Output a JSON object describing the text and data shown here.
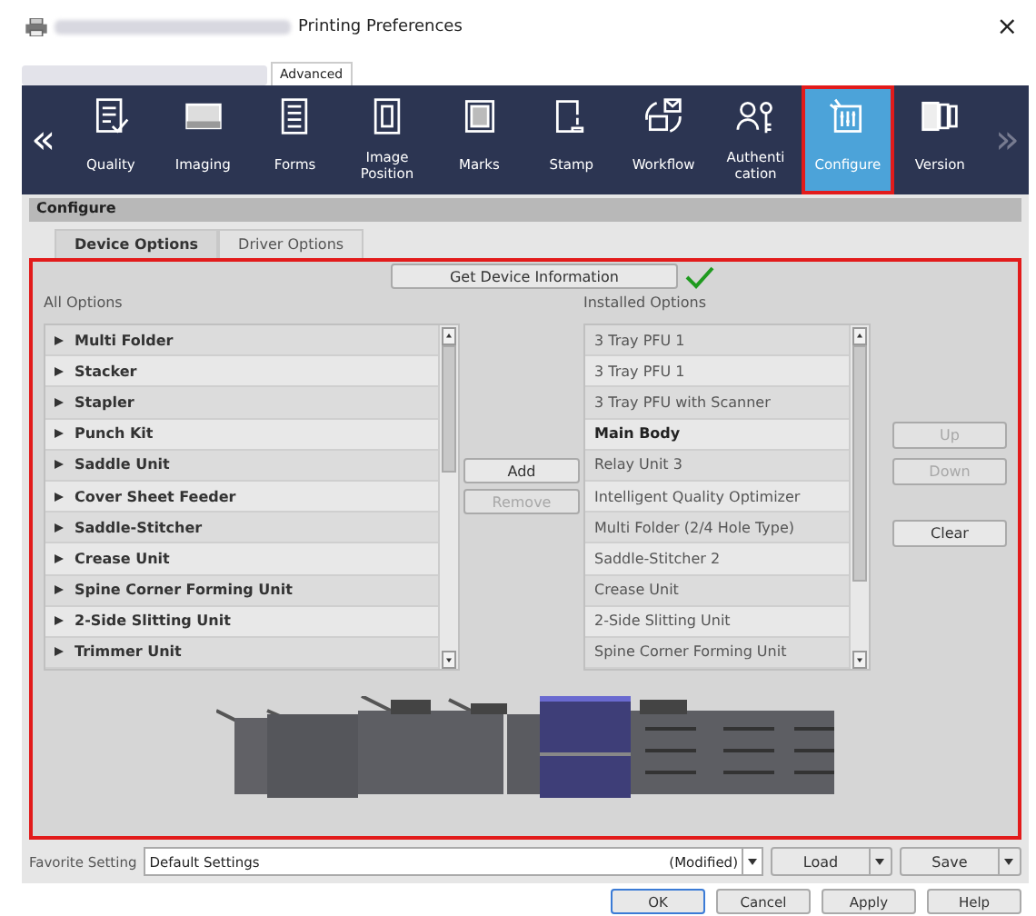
{
  "window": {
    "title": "Printing Preferences",
    "close": "×"
  },
  "top_tabs": [
    {
      "label": "Advanced",
      "selected": true
    }
  ],
  "nav": {
    "prev": "«",
    "next": "»",
    "items": [
      {
        "label": "Quality",
        "selected": false
      },
      {
        "label": "Imaging",
        "selected": false
      },
      {
        "label": "Forms",
        "selected": false
      },
      {
        "label": "Image Position",
        "selected": false
      },
      {
        "label": "Marks",
        "selected": false
      },
      {
        "label": "Stamp",
        "selected": false
      },
      {
        "label": "Workflow",
        "selected": false
      },
      {
        "label": "Authenti cation",
        "selected": false
      },
      {
        "label": "Configure",
        "selected": true
      },
      {
        "label": "Version",
        "selected": false
      }
    ]
  },
  "section_title": "Configure",
  "sub_tabs": [
    {
      "label": "Device Options",
      "selected": true
    },
    {
      "label": "Driver Options",
      "selected": false
    }
  ],
  "get_info_button": "Get Device Information",
  "all_options": {
    "label": "All Options",
    "items": [
      {
        "text": "Multi Folder",
        "expanded": false
      },
      {
        "text": "Stacker",
        "expanded": false
      },
      {
        "text": "Stapler",
        "expanded": false
      },
      {
        "text": "Punch Kit",
        "expanded": false
      },
      {
        "text": "Saddle Unit",
        "expanded": false
      },
      {
        "text": "Cover Sheet Feeder",
        "expanded": false
      },
      {
        "text": "Saddle-Stitcher",
        "expanded": false
      },
      {
        "text": "Crease Unit",
        "expanded": false
      },
      {
        "text": "Spine Corner Forming Unit",
        "expanded": false
      },
      {
        "text": "2-Side Slitting Unit",
        "expanded": false
      },
      {
        "text": "Trimmer Unit",
        "expanded": false
      }
    ]
  },
  "middle_buttons": [
    {
      "label": "Add",
      "disabled": false
    },
    {
      "label": "Remove",
      "disabled": true
    }
  ],
  "installed_options": {
    "label": "Installed Options",
    "items": [
      {
        "text": "3 Tray PFU 1",
        "kind": "option"
      },
      {
        "text": "3 Tray PFU 1",
        "kind": "option"
      },
      {
        "text": "3 Tray PFU with Scanner",
        "kind": "option"
      },
      {
        "text": "Main Body",
        "kind": "main"
      },
      {
        "text": "Relay Unit 3",
        "kind": "option"
      },
      {
        "text": "Intelligent Quality Optimizer",
        "kind": "option"
      },
      {
        "text": "Multi Folder (2/4 Hole Type)",
        "kind": "option"
      },
      {
        "text": "Saddle-Stitcher 2",
        "kind": "option"
      },
      {
        "text": "Crease Unit",
        "kind": "option"
      },
      {
        "text": "2-Side Slitting Unit",
        "kind": "option"
      },
      {
        "text": "Spine Corner Forming Unit",
        "kind": "option"
      }
    ]
  },
  "side_buttons": [
    {
      "label": "Up",
      "disabled": true
    },
    {
      "label": "Down",
      "disabled": true
    },
    {
      "label": "Clear",
      "disabled": false
    }
  ],
  "favorite": {
    "label": "Favorite Setting",
    "value": "Default Settings",
    "note": "(Modified)",
    "buttons": [
      "Load",
      "Save"
    ]
  },
  "dialog_buttons": [
    "OK",
    "Cancel",
    "Apply",
    "Help"
  ]
}
